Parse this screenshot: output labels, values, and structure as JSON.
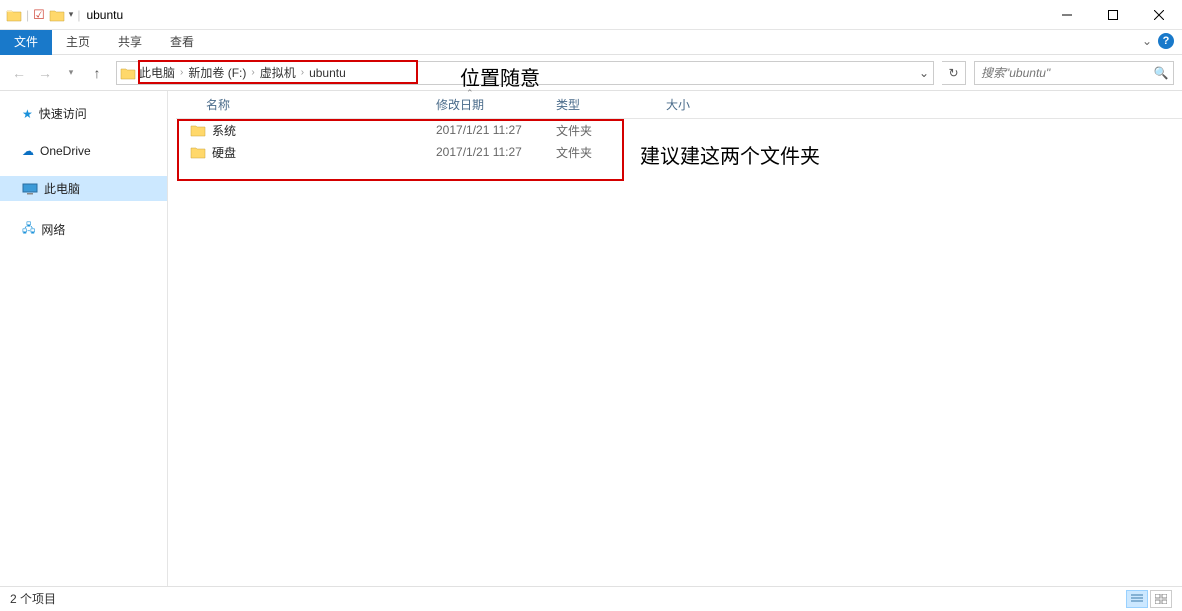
{
  "titlebar": {
    "title": "ubuntu"
  },
  "ribbon": {
    "file": "文件",
    "tabs": [
      "主页",
      "共享",
      "查看"
    ]
  },
  "breadcrumb": [
    "此电脑",
    "新加卷 (F:)",
    "虚拟机",
    "ubuntu"
  ],
  "search": {
    "placeholder": "搜索\"ubuntu\""
  },
  "sidebar": {
    "quick": "快速访问",
    "onedrive": "OneDrive",
    "thispc": "此电脑",
    "network": "网络"
  },
  "columns": {
    "name": "名称",
    "modified": "修改日期",
    "type": "类型",
    "size": "大小"
  },
  "rows": [
    {
      "name": "系统",
      "modified": "2017/1/21 11:27",
      "type": "文件夹"
    },
    {
      "name": "硬盘",
      "modified": "2017/1/21 11:27",
      "type": "文件夹"
    }
  ],
  "annotations": {
    "bc": "位置随意",
    "rows": "建议建这两个文件夹"
  },
  "status": {
    "count": "2 个项目"
  }
}
